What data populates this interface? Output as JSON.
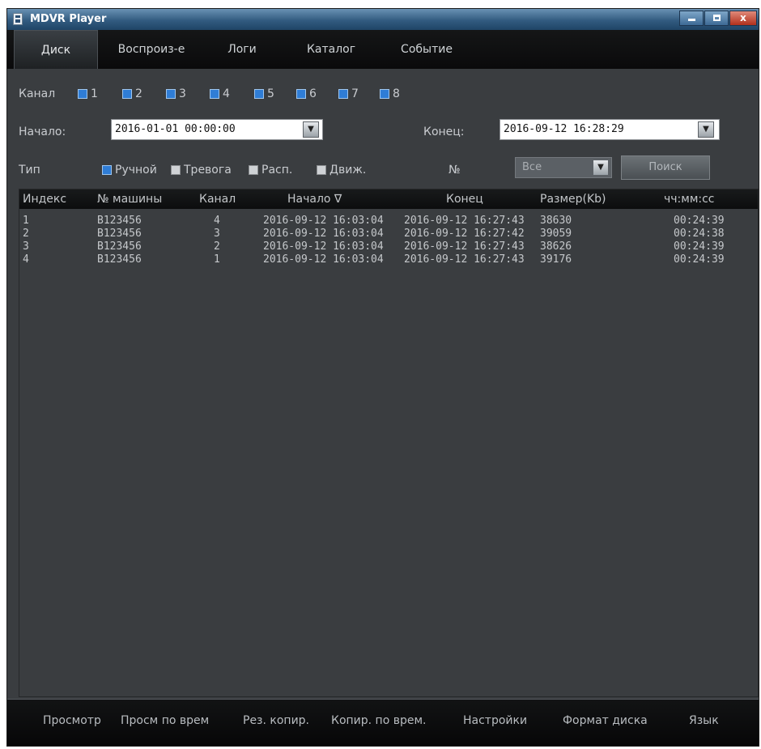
{
  "window": {
    "title": "MDVR Player",
    "minimize": "",
    "close": "x"
  },
  "tabs": [
    "Диск",
    "Воспроиз-е",
    "Логи",
    "Каталог",
    "Событие"
  ],
  "filters": {
    "channel_label": "Канал",
    "channels": [
      "1",
      "2",
      "3",
      "4",
      "5",
      "6",
      "7",
      "8"
    ],
    "start_label": "Начало:",
    "start_value": "2016-01-01 00:00:00",
    "end_label": "Конец:",
    "end_value": "2016-09-12 16:28:29",
    "type_label": "Тип",
    "types": [
      "Ручной",
      "Тревога",
      "Расп.",
      "Движ."
    ],
    "number_label": "№",
    "number_value": "Все",
    "search_label": "Поиск"
  },
  "table": {
    "headers": [
      "Индекс",
      "№ машины",
      "Канал",
      "Начало ∇",
      "Конец",
      "Размер(Kb)",
      "чч:мм:сс"
    ],
    "rows": [
      [
        "1",
        "B123456",
        "4",
        "2016-09-12 16:03:04",
        "2016-09-12 16:27:43",
        "38630",
        "00:24:39"
      ],
      [
        "2",
        "B123456",
        "3",
        "2016-09-12 16:03:04",
        "2016-09-12 16:27:42",
        "39059",
        "00:24:38"
      ],
      [
        "3",
        "B123456",
        "2",
        "2016-09-12 16:03:04",
        "2016-09-12 16:27:43",
        "38626",
        "00:24:39"
      ],
      [
        "4",
        "B123456",
        "1",
        "2016-09-12 16:03:04",
        "2016-09-12 16:27:43",
        "39176",
        "00:24:39"
      ]
    ]
  },
  "bottom_buttons": [
    "Просмотр",
    "Просм по врем",
    "Рез. копир.",
    "Копир. по врем.",
    "Настройки",
    "Формат диска",
    "Язык"
  ]
}
